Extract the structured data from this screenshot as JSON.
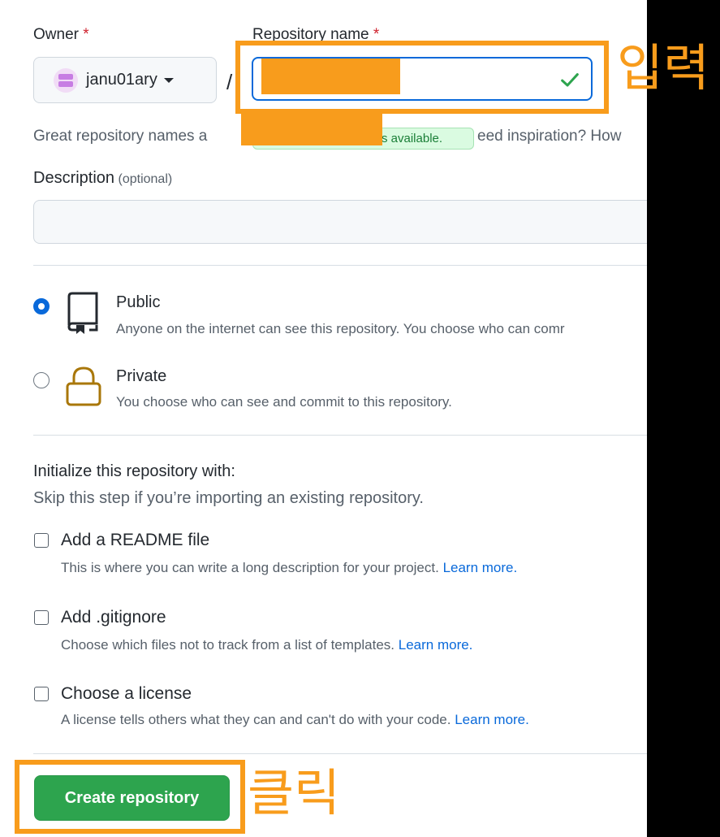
{
  "form": {
    "owner_label": "Owner",
    "required_mark": "*",
    "owner_value": "janu01ary",
    "repo_name_label": "Repository name",
    "separator": "/",
    "repo_name_value": "",
    "availability_fragment": "s available.",
    "helper_left": "Great repository names a",
    "helper_right": "eed inspiration? How",
    "description_label": "Description",
    "description_optional": "(optional)",
    "description_value": ""
  },
  "visibility": {
    "selected": "public",
    "public": {
      "title": "Public",
      "subtitle": "Anyone on the internet can see this repository. You choose who can comr"
    },
    "private": {
      "title": "Private",
      "subtitle": "You choose who can see and commit to this repository."
    }
  },
  "initialize": {
    "heading": "Initialize this repository with:",
    "subheading": "Skip this step if you’re importing an existing repository.",
    "readme": {
      "title": "Add a README file",
      "subtitle": "This is where you can write a long description for your project.",
      "link": "Learn more."
    },
    "gitignore": {
      "title": "Add .gitignore",
      "subtitle": "Choose which files not to track from a list of templates.",
      "link": "Learn more."
    },
    "license": {
      "title": "Choose a license",
      "subtitle": "A license tells others what they can and can't do with your code.",
      "link": "Learn more."
    }
  },
  "actions": {
    "create_label": "Create repository"
  },
  "annotations": {
    "input_note": "입력",
    "click_note": "클릭",
    "highlight_color": "#f89c1c"
  },
  "colors": {
    "primary_button": "#2da44e",
    "focus_border": "#0969da",
    "success_text": "#1a7f37",
    "link": "#0969da"
  },
  "icons": {
    "owner_caret": "chevron-down-icon",
    "valid": "check-icon",
    "public": "repo-book-icon",
    "private": "lock-icon"
  }
}
